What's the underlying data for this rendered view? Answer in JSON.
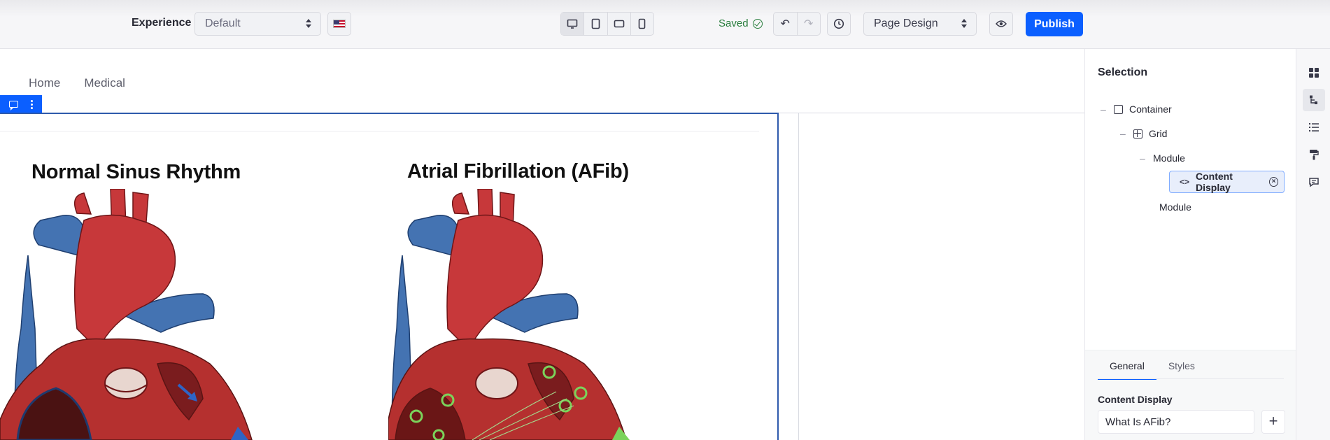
{
  "toolbar": {
    "experience_label": "Experience",
    "experience_select": "Default",
    "locale_icon": "us-flag-icon",
    "devices": [
      "desktop-icon",
      "tablet-icon",
      "landscape-phone-icon",
      "portrait-phone-icon"
    ],
    "saved_label": "Saved",
    "mode_select": "Page Design",
    "publish_label": "Publish"
  },
  "page": {
    "nav_items": [
      "Home",
      "Medical"
    ],
    "left_heading": "Normal Sinus Rhythm",
    "right_heading": "Atrial Fibrillation (AFib)"
  },
  "selection_panel": {
    "title": "Selection",
    "tree": {
      "container": "Container",
      "grid": "Grid",
      "module_1": "Module",
      "selected": "Content Display",
      "module_2": "Module"
    },
    "tabs": [
      "General",
      "Styles"
    ],
    "field_label": "Content Display",
    "field_value": "What Is AFib?"
  },
  "colors": {
    "primary": "#0b5fff",
    "saved_green": "#287d3c",
    "outline_blue": "#2e5aac",
    "heart_red": "#c7383a",
    "vessel_blue": "#4473b2"
  }
}
